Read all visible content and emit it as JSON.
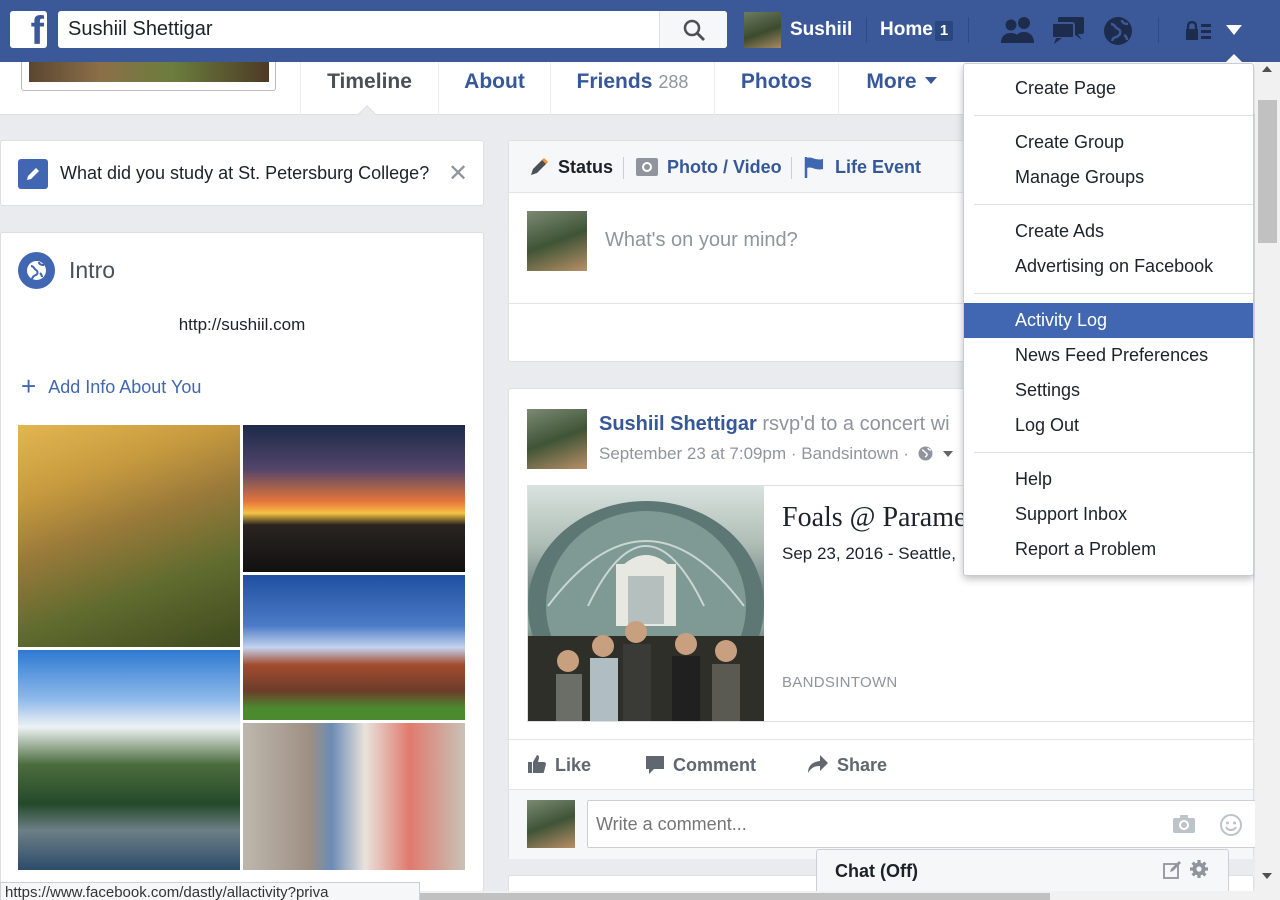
{
  "topbar": {
    "search_value": "Sushiil Shettigar",
    "user_name": "Sushiil",
    "home_label": "Home",
    "home_badge": "1",
    "icons": [
      "friend-requests-icon",
      "messages-icon",
      "notifications-globe-icon",
      "privacy-lock-icon",
      "account-menu-caret-icon"
    ],
    "brand_color": "#3b5998"
  },
  "profile_tabs": [
    {
      "label": "Timeline"
    },
    {
      "label": "About"
    },
    {
      "label": "Friends",
      "count": "288"
    },
    {
      "label": "Photos"
    },
    {
      "label": "More"
    }
  ],
  "study_prompt": {
    "text": "What did you study at St. Petersburg College?",
    "close": "✕"
  },
  "intro": {
    "title": "Intro",
    "website": "http://sushiil.com",
    "add_info": "Add Info About You",
    "add_plus": "+"
  },
  "composer": {
    "tabs": [
      "Status",
      "Photo / Video",
      "Life Event"
    ],
    "placeholder": "What's on your mind?"
  },
  "post": {
    "author": "Sushiil Shettigar",
    "action_text": "rsvp'd to a concert wi",
    "meta": "September 23 at 7:09pm · Bandsintown ·",
    "attachment": {
      "title": "Foals @ Parame",
      "date_bold": "Sep 23, 2016",
      "date_rest": " - Seattle,",
      "source": "BANDSINTOWN"
    },
    "actions": [
      "Like",
      "Comment",
      "Share"
    ],
    "comment_placeholder": "Write a comment..."
  },
  "chat": {
    "label": "Chat (Off)"
  },
  "menu": {
    "groups": [
      [
        "Create Page"
      ],
      [
        "Create Group",
        "Manage Groups"
      ],
      [
        "Create Ads",
        "Advertising on Facebook"
      ],
      [
        "Activity Log",
        "News Feed Preferences",
        "Settings",
        "Log Out"
      ],
      [
        "Help",
        "Support Inbox",
        "Report a Problem"
      ]
    ],
    "highlighted": "Activity Log",
    "highlight_color": "#4267b2"
  },
  "status_bar": {
    "url": "https://www.facebook.com/dastly/allactivity?priva"
  }
}
